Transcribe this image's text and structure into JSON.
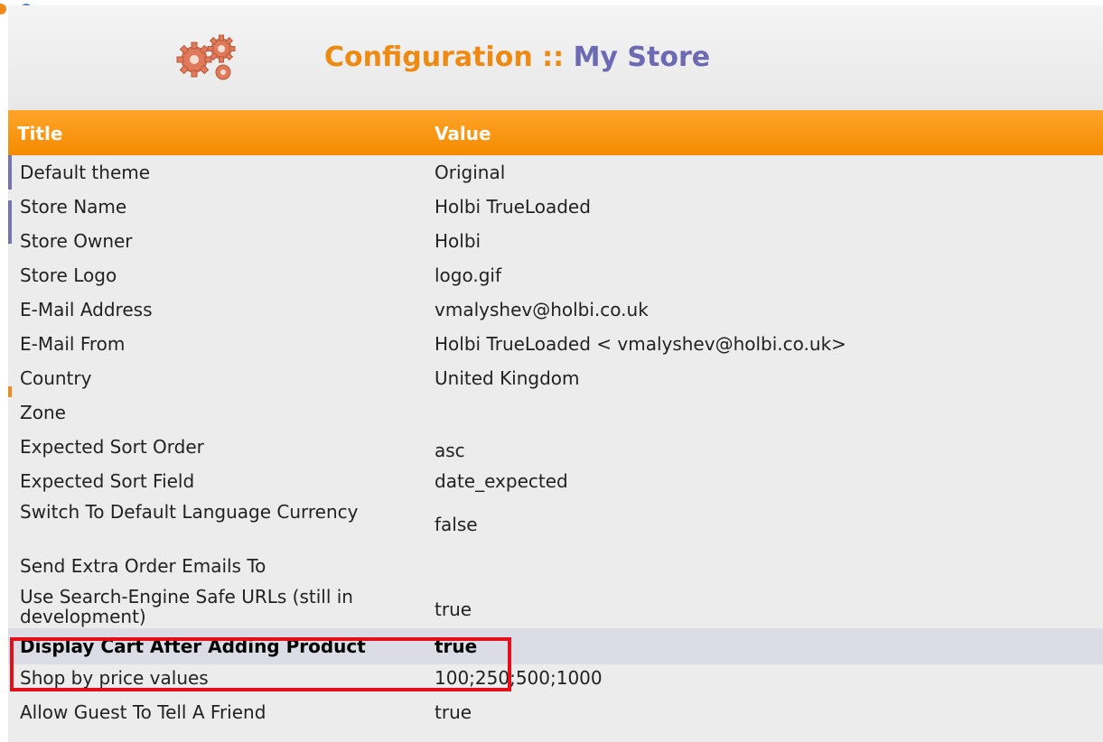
{
  "header": {
    "title_prefix": "Configuration :: ",
    "title_store": "My Store",
    "icon": "gears-icon"
  },
  "table": {
    "columns": {
      "title": "Title",
      "value": "Value"
    },
    "rows": [
      {
        "title": "Default theme",
        "value": "Original"
      },
      {
        "title": "Store Name",
        "value": "Holbi TrueLoaded"
      },
      {
        "title": "Store Owner",
        "value": "Holbi"
      },
      {
        "title": "Store Logo",
        "value": "logo.gif"
      },
      {
        "title": "E-Mail Address",
        "value": "vmalyshev@holbi.co.uk"
      },
      {
        "title": "E-Mail From",
        "value": "Holbi TrueLoaded < vmalyshev@holbi.co.uk>"
      },
      {
        "title": "Country",
        "value": "United Kingdom"
      },
      {
        "title": "Zone",
        "value": ""
      },
      {
        "title": "Expected Sort Order",
        "value": "asc"
      },
      {
        "title": "Expected Sort Field",
        "value": "date_expected"
      },
      {
        "title": "Switch To Default Language Currency",
        "value": "false"
      },
      {
        "title": "Send Extra Order Emails To",
        "value": ""
      },
      {
        "title": "Use Search-Engine Safe URLs (still in development)",
        "value": "true"
      },
      {
        "title": "Display Cart After Adding Product",
        "value": "true"
      },
      {
        "title": "Shop by price values",
        "value": "100;250;500;1000"
      },
      {
        "title": "Allow Guest To Tell A Friend",
        "value": "true"
      }
    ],
    "selected_row_index": 13
  },
  "colors": {
    "accent_orange": "#f58a00",
    "title_store": "#6b6ab2",
    "highlight": "#e3101c"
  }
}
